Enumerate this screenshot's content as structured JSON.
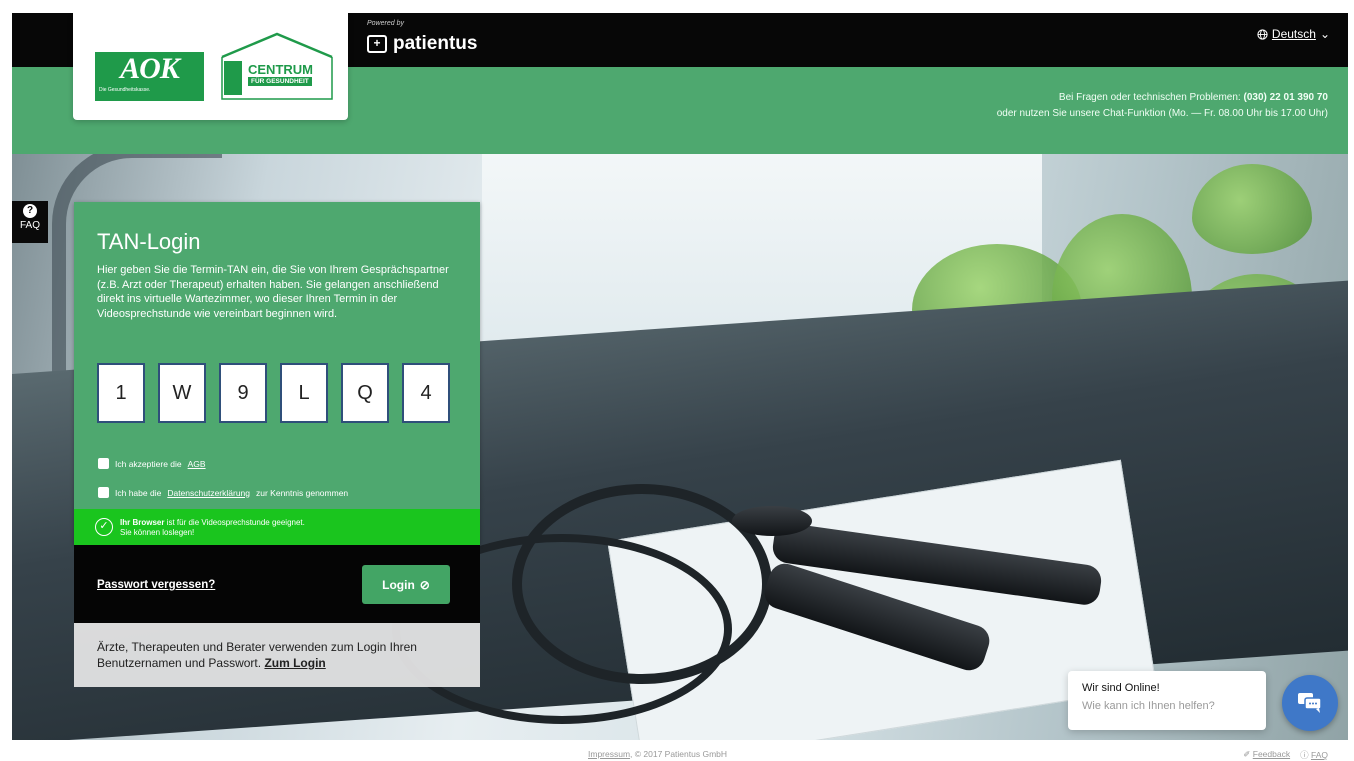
{
  "header": {
    "powered_by": "Powered by",
    "brand": "patientus",
    "language": "Deutsch",
    "logos": {
      "aok_word": "AOK",
      "aok_tagline": "Die Gesundheitskasse.",
      "centrum_word": "CENTRUM",
      "centrum_sub": "FÜR GESUNDHEIT"
    },
    "support_line1_prefix": "Bei Fragen oder technischen Problemen:",
    "support_phone": "(030) 22 01 390 70",
    "support_line2": "oder nutzen Sie unsere Chat-Funktion (Mo. — Fr. 08.00 Uhr bis 17.00 Uhr)"
  },
  "faq_tab": {
    "icon": "question-icon",
    "label": "FAQ"
  },
  "login": {
    "title": "TAN-Login",
    "description": "Hier geben Sie die Termin-TAN ein, die Sie von Ihrem Gesprächspartner (z.B. Arzt oder Therapeut) erhalten haben. Sie gelangen anschließend direkt ins virtuelle Wartezimmer, wo dieser Ihren Termin in der Videosprechstunde wie vereinbart beginnen wird.",
    "tan": [
      "1",
      "W",
      "9",
      "L",
      "Q",
      "4"
    ],
    "agb_prefix": "Ich akzeptiere die",
    "agb_link": "AGB",
    "privacy_prefix": "Ich habe die",
    "privacy_link": "Datenschutzerklärung",
    "privacy_suffix": "zur Kenntnis genommen",
    "browser_bold": "Ihr Browser",
    "browser_rest": "ist für die Videosprechstunde geeignet.",
    "browser_line2": "Sie können loslegen!",
    "forgot": "Passwort vergessen?",
    "login_button": "Login"
  },
  "pro": {
    "text": "Ärzte, Therapeuten und Berater verwenden zum Login Ihren Benutzernamen und Passwort.",
    "link": "Zum Login"
  },
  "chat": {
    "title": "Wir sind Online!",
    "subtitle": "Wie kann ich Ihnen helfen?",
    "icon": "chat-bubbles-icon"
  },
  "footer": {
    "impressum": "Impressum",
    "copyright": ", © 2017 Patientus GmbH",
    "feedback": "Feedback",
    "faq": "FAQ"
  },
  "colors": {
    "green": "#4ea86f",
    "bright_green": "#1ac51e",
    "aok_green": "#1f9a4a",
    "chat_blue": "#3f78c8"
  }
}
